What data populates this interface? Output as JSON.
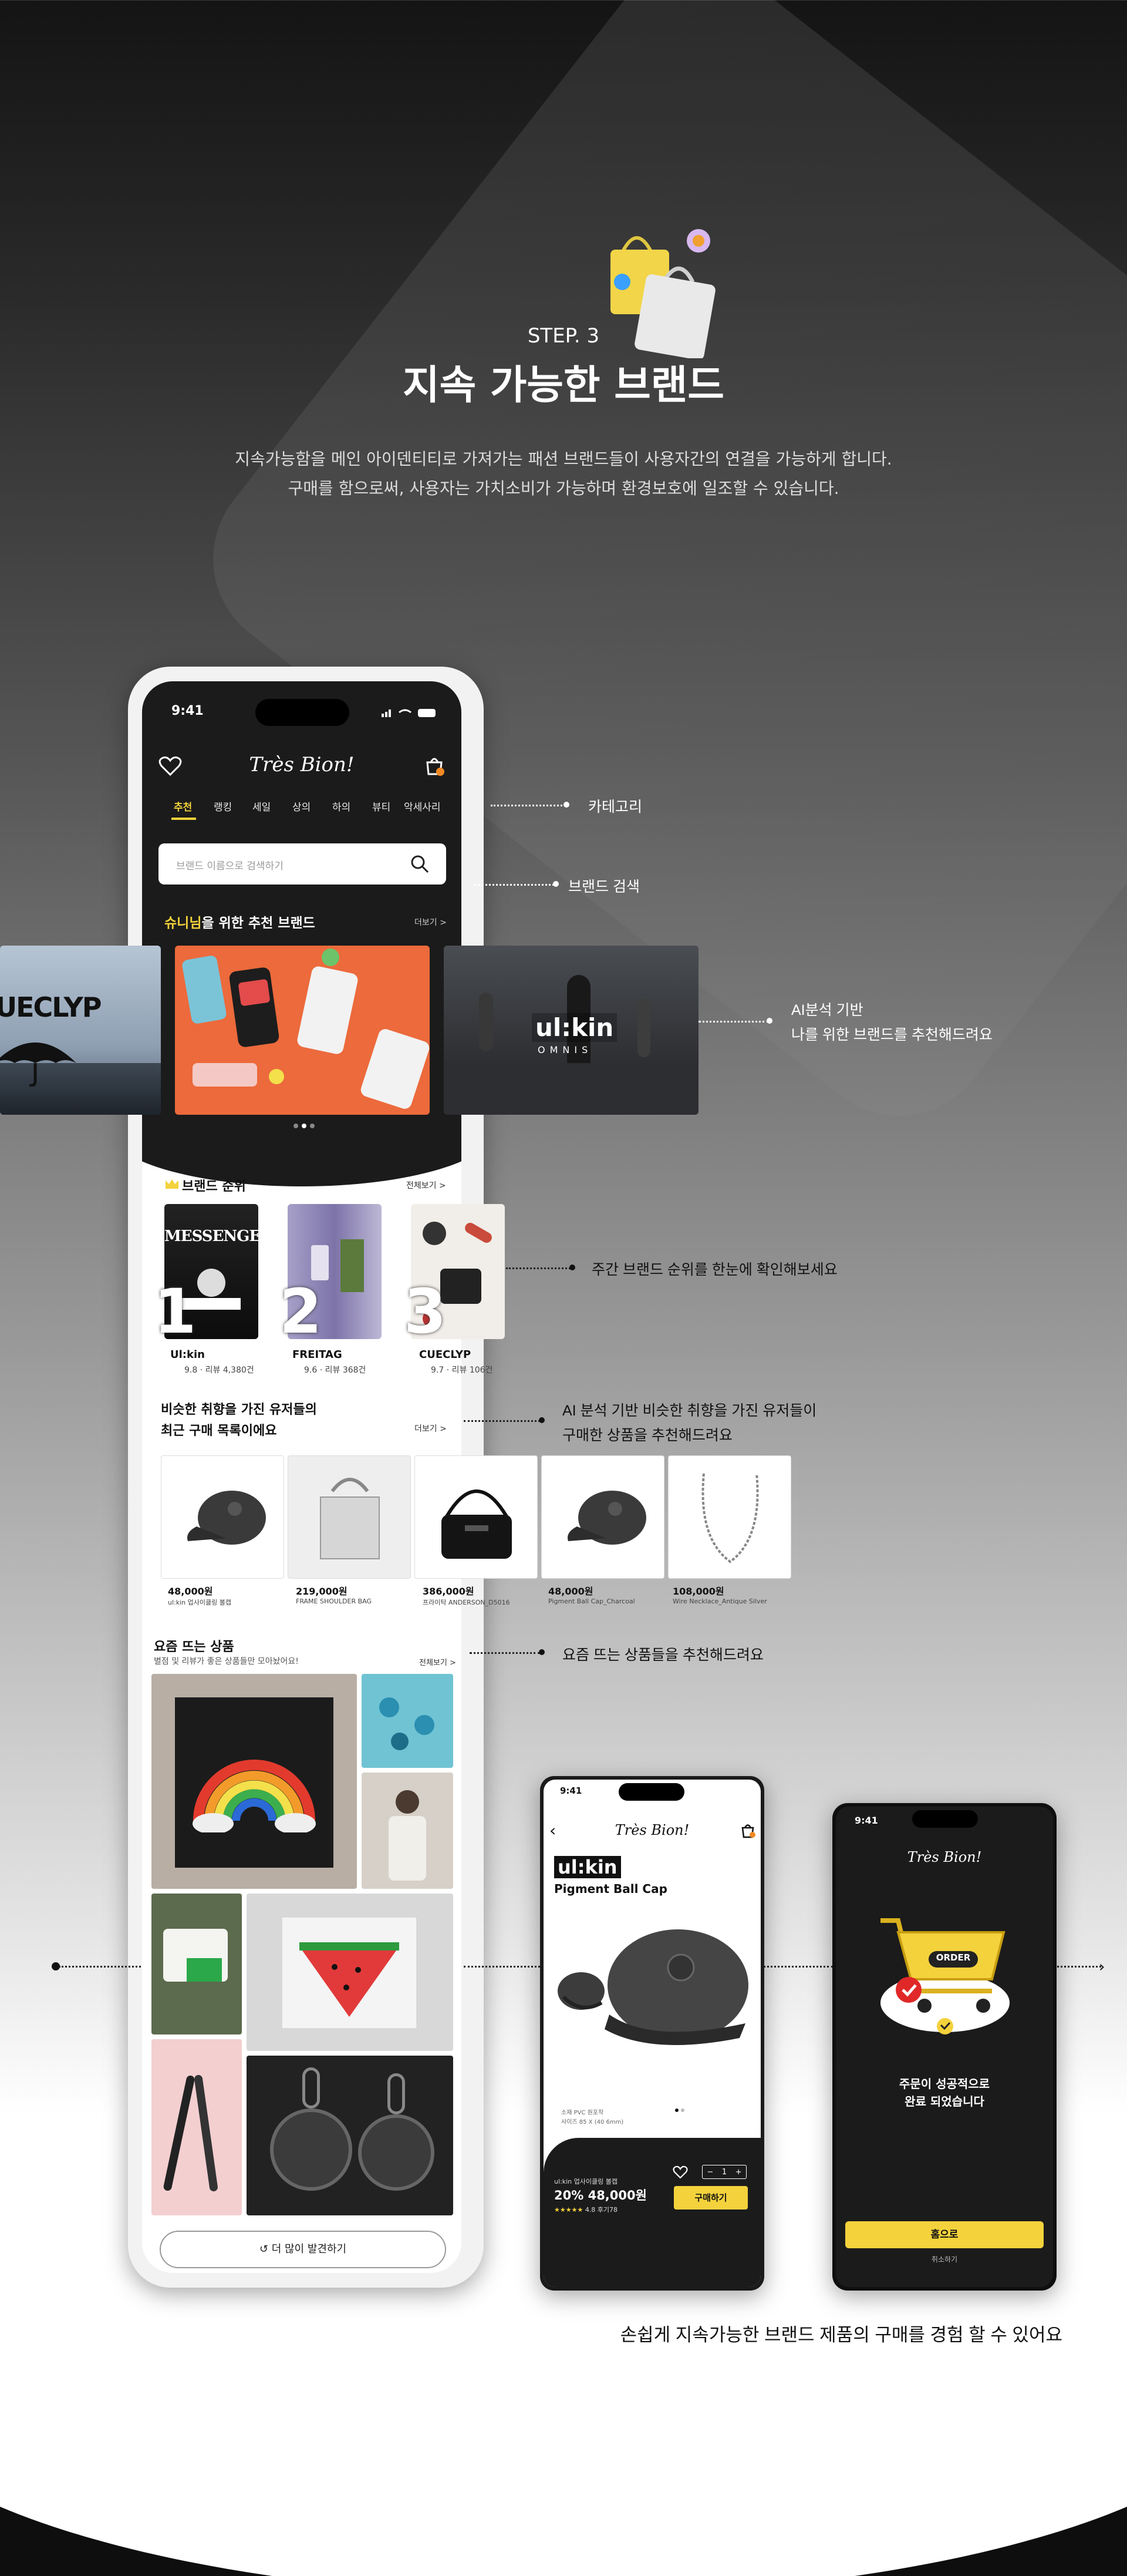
{
  "header": {
    "step": "STEP. 3",
    "title": "지속 가능한 브랜드",
    "desc1": "지속가능함을 메인 아이덴티티로 가져가는 패션 브랜드들이 사용자간의 연결을 가능하게 합니다.",
    "desc2": "구매를 함으로써, 사용자는 가치소비가 가능하며 환경보호에 일조할 수 있습니다."
  },
  "main_phone": {
    "time": "9:41",
    "logo": "Très Bion!",
    "tabs": [
      "추천",
      "랭킹",
      "세일",
      "상의",
      "하의",
      "뷰티",
      "악세사리"
    ],
    "search_placeholder": "브랜드 이름으로 검색하기",
    "rec_title_name": "슈니님",
    "rec_title_rest": "을 위한 추천 브랜드",
    "more": "더보기 >",
    "carousel_left_brand": "CUECLYP",
    "carousel_right_brand": "ul:kin",
    "carousel_right_sub": "OMNIS",
    "ranking_title": "브랜드 순위",
    "ranking_more": "전체보기 >",
    "ranking": [
      {
        "rank": "1",
        "name": "Ul:kin",
        "meta": "9.8 · 리뷰 4,380건",
        "poster": "MESSENGER"
      },
      {
        "rank": "2",
        "name": "FREITAG",
        "meta": "9.6 · 리뷰 368건"
      },
      {
        "rank": "3",
        "name": "CUECLYP",
        "meta": "9.7 · 리뷰 106건"
      }
    ],
    "similar_title1": "비슷한 취향을 가진 유저들의",
    "similar_title2": "최근 구매 목록이에요",
    "similar_more": "더보기 >",
    "products": [
      {
        "price": "48,000원",
        "name": "ul:kin 업사이클링 볼캡"
      },
      {
        "price": "219,000원",
        "name": "FRAME SHOULDER BAG"
      },
      {
        "price": "386,000원",
        "name": "프라이탁 ANDERSON_D5016"
      },
      {
        "price": "48,000원",
        "name": "Pigment Ball Cap_Charcoal"
      },
      {
        "price": "108,000원",
        "name": "Wire Necklace_Antique Silver"
      }
    ],
    "trending_title": "요즘 뜨는 상품",
    "trending_sub": "별점 및 리뷰가 좋은 상품들만 모아놨어요!",
    "trending_more": "전체보기 >",
    "discover_button": "더 많이 발견하기"
  },
  "callouts": {
    "category": "카테고리",
    "search": "브랜드 검색",
    "ai1": "AI분석 기반",
    "ai2": "나를 위한 브랜드를 추천해드려요",
    "ranking": "주간 브랜드 순위를 한눈에 확인해보세요",
    "similar1": "AI 분석 기반 비슷한 취향을 가진 유저들이",
    "similar2": "구매한 상품을 추천해드려요",
    "trending": "요즘 뜨는 상품들을 추천해드려요"
  },
  "product_phone": {
    "time": "9:41",
    "logo": "Très Bion!",
    "brand": "ul:kin",
    "product": "Pigment Ball Cap",
    "material1": "소재 PVC 원포착",
    "material2": "사이즈 85 X (40 6mm)",
    "name_small": "ul:kin 업사이클링 볼캡",
    "discount": "20%",
    "price": "48,000원",
    "rating": "4.8",
    "reviews": "후기78",
    "qty": "1",
    "buy": "구매하기"
  },
  "order_phone": {
    "time": "9:41",
    "logo": "Très Bion!",
    "cart_label": "ORDER",
    "msg1": "주문이 성공적으로",
    "msg2": "완료 되었습니다",
    "home": "홈으로",
    "cancel": "취소하기"
  },
  "footer": {
    "caption": "손쉽게 지속가능한 브랜드 제품의 구매를 경험 할 수 있어요"
  },
  "colors": {
    "accent": "#F4D23C",
    "dark": "#1b1b1b"
  }
}
